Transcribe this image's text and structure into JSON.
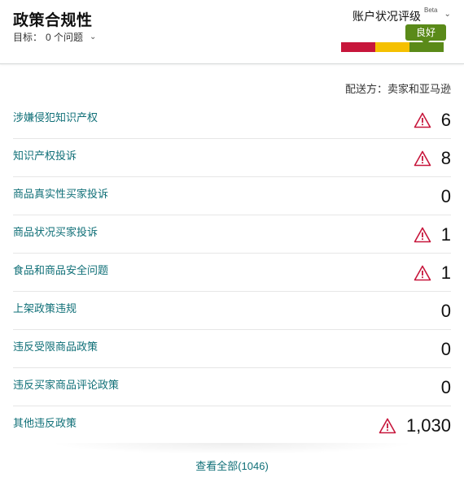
{
  "header": {
    "title": "政策合规性",
    "goal_label": "目标：",
    "goal_value": "0 个问题",
    "health_label": "账户状况评级",
    "beta": "Beta",
    "health_status": "良好",
    "colors": {
      "red": "#c7163b",
      "yellow": "#f5c000",
      "green": "#5a8a19"
    }
  },
  "fulfillment": "配送方：卖家和亚马逊",
  "rows": [
    {
      "label": "涉嫌侵犯知识产权",
      "count": "6",
      "warning": true
    },
    {
      "label": "知识产权投诉",
      "count": "8",
      "warning": true
    },
    {
      "label": "商品真实性买家投诉",
      "count": "0",
      "warning": false
    },
    {
      "label": "商品状况买家投诉",
      "count": "1",
      "warning": true
    },
    {
      "label": "食品和商品安全问题",
      "count": "1",
      "warning": true
    },
    {
      "label": "上架政策违规",
      "count": "0",
      "warning": false
    },
    {
      "label": "违反受限商品政策",
      "count": "0",
      "warning": false
    },
    {
      "label": "违反买家商品评论政策",
      "count": "0",
      "warning": false
    },
    {
      "label": "其他违反政策",
      "count": "1,030",
      "warning": true
    }
  ],
  "footer": {
    "view_all": "查看全部(1046)"
  },
  "icons": {
    "warning": "warning-triangle-icon",
    "chevron": "chevron-down-icon"
  }
}
